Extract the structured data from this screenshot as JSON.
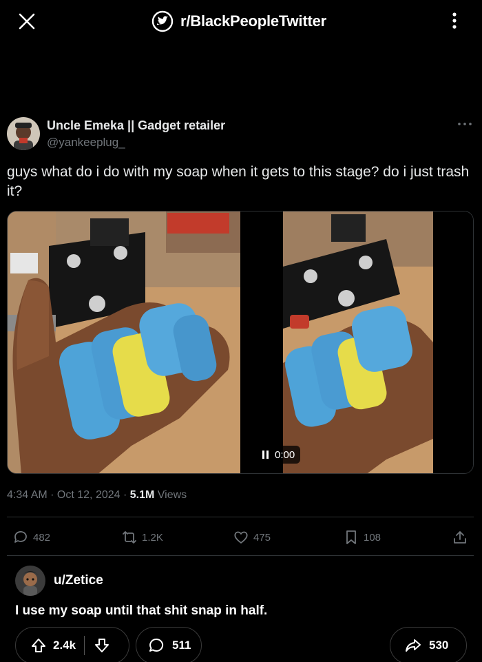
{
  "topbar": {
    "subreddit": "r/BlackPeopleTwitter",
    "close_icon": "close-icon",
    "more_icon": "vertical-dots-icon"
  },
  "tweet": {
    "author_name": "Uncle Emeka || Gadget retailer",
    "author_handle": "@yankeeplug_",
    "text": "guys what do i do with my soap when it gets to this stage? do i just trash it?",
    "video_time": "0:00",
    "time": "4:34 AM",
    "sep1": " · ",
    "date": "Oct 12, 2024",
    "sep2": " · ",
    "views_count": "5.1M",
    "views_label": " Views",
    "replies": "482",
    "retweets": "1.2K",
    "likes": "475",
    "bookmarks": "108"
  },
  "comment": {
    "username": "u/Zetice",
    "text": "I use my soap until that shit snap in half.",
    "upvotes": "2.4k",
    "comments": "511",
    "shares": "530"
  },
  "colors": {
    "background": "#000000",
    "text_primary": "#e7e9ea",
    "text_secondary": "#71767b",
    "divider": "#2f3336",
    "soap_blue": "#4ea3d8",
    "soap_yellow": "#e6dc4a"
  }
}
